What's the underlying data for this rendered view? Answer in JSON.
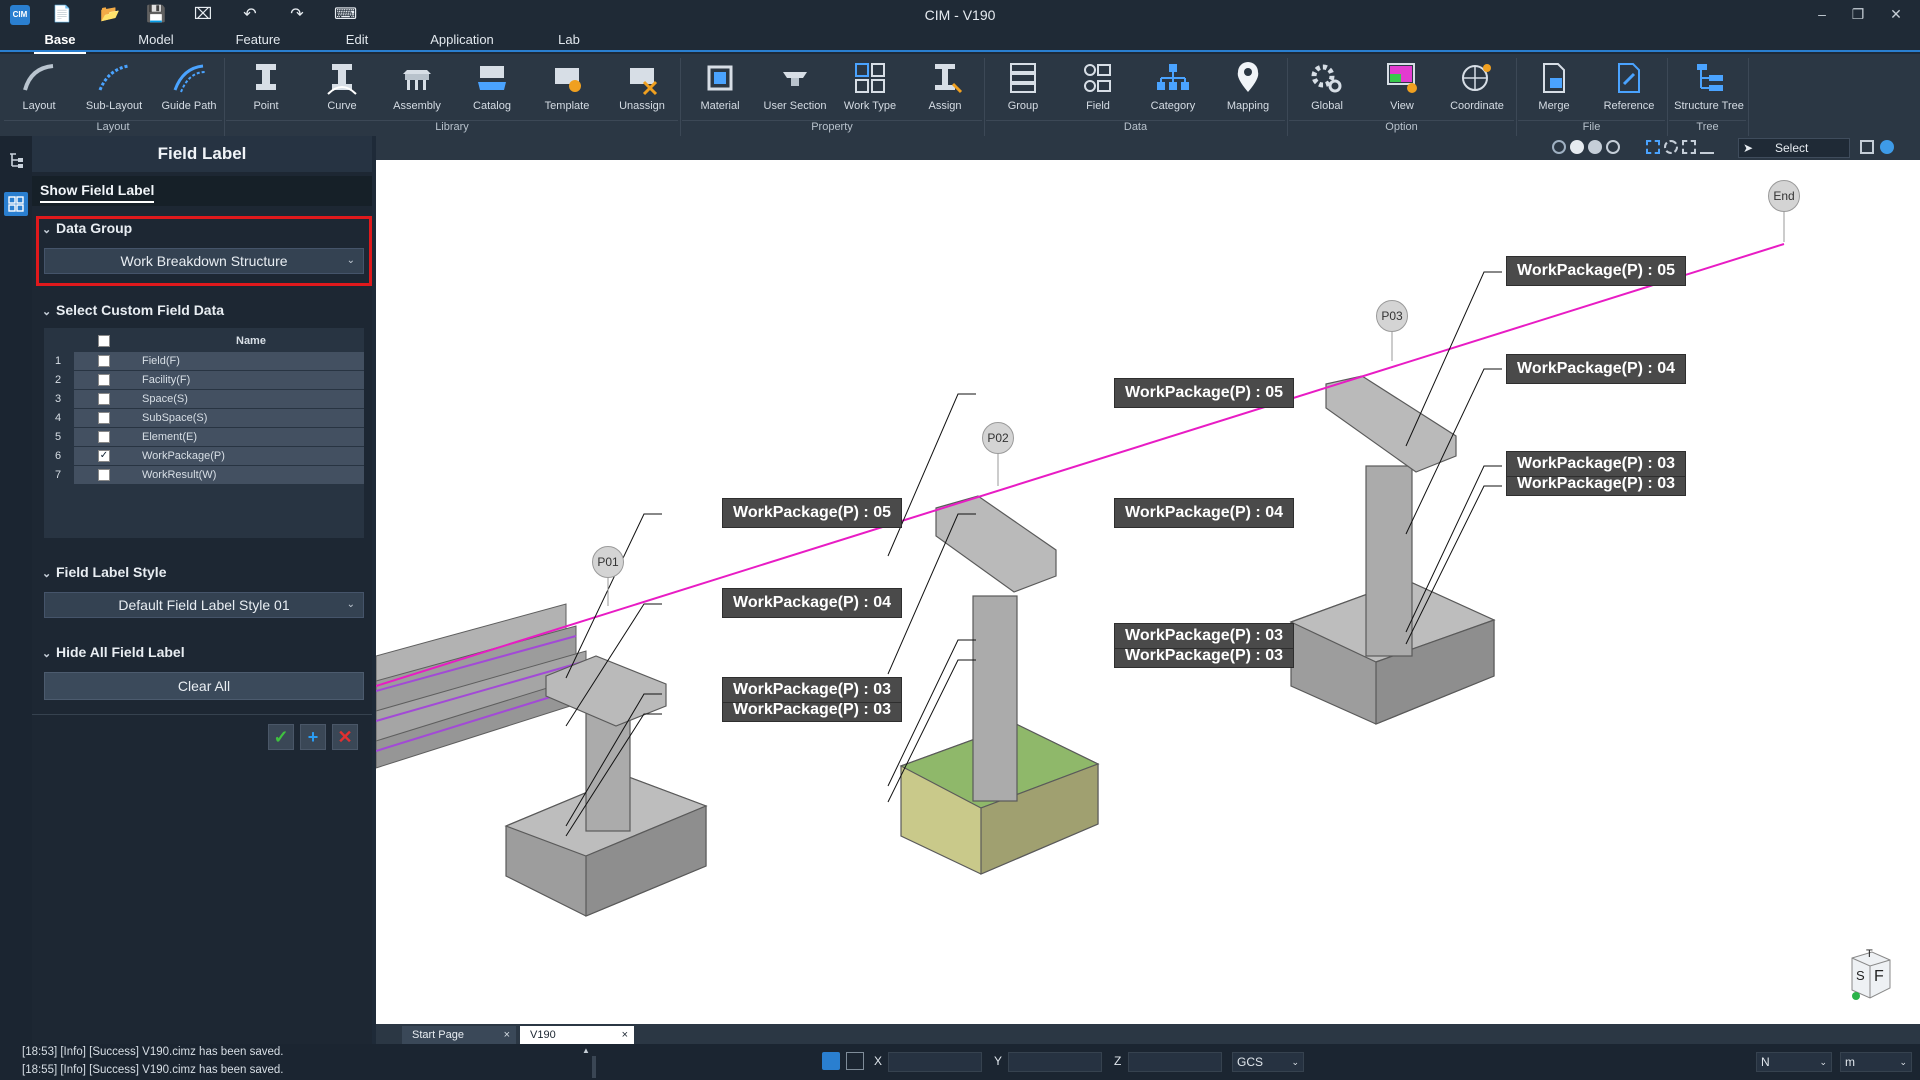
{
  "window": {
    "title": "CIM - V190"
  },
  "menu": {
    "tabs": [
      {
        "label": "Base"
      },
      {
        "label": "Model"
      },
      {
        "label": "Feature"
      },
      {
        "label": "Edit"
      },
      {
        "label": "Application"
      },
      {
        "label": "Lab"
      }
    ]
  },
  "ribbon": {
    "buttons": [
      {
        "label": "Layout",
        "icon": "layout-icon"
      },
      {
        "label": "Sub-Layout",
        "icon": "sub-layout-icon"
      },
      {
        "label": "Guide Path",
        "icon": "guide-path-icon"
      },
      {
        "label": "Point",
        "icon": "point-icon"
      },
      {
        "label": "Curve",
        "icon": "curve-icon"
      },
      {
        "label": "Assembly",
        "icon": "assembly-icon"
      },
      {
        "label": "Catalog",
        "icon": "catalog-icon"
      },
      {
        "label": "Template",
        "icon": "template-icon"
      },
      {
        "label": "Unassign",
        "icon": "unassign-icon"
      },
      {
        "label": "Material",
        "icon": "material-icon"
      },
      {
        "label": "User Section",
        "icon": "user-section-icon"
      },
      {
        "label": "Work Type",
        "icon": "work-type-icon"
      },
      {
        "label": "Assign",
        "icon": "assign-icon"
      },
      {
        "label": "Group",
        "icon": "group-icon"
      },
      {
        "label": "Field",
        "icon": "field-icon"
      },
      {
        "label": "Category",
        "icon": "category-icon"
      },
      {
        "label": "Mapping",
        "icon": "mapping-icon"
      },
      {
        "label": "Global",
        "icon": "global-icon"
      },
      {
        "label": "View",
        "icon": "view-icon"
      },
      {
        "label": "Coordinate",
        "icon": "coordinate-icon"
      },
      {
        "label": "Merge",
        "icon": "merge-icon"
      },
      {
        "label": "Reference",
        "icon": "reference-icon"
      },
      {
        "label": "Structure Tree",
        "icon": "structure-tree-icon"
      }
    ],
    "groups": [
      {
        "label": "Layout"
      },
      {
        "label": "Library"
      },
      {
        "label": "Property"
      },
      {
        "label": "Data"
      },
      {
        "label": "Option"
      },
      {
        "label": "File"
      },
      {
        "label": "Tree"
      }
    ]
  },
  "panel": {
    "title": "Field Label",
    "show_field_label": "Show Field Label",
    "data_group": {
      "heading": "Data Group",
      "value": "Work Breakdown Structure"
    },
    "custom_field": {
      "heading": "Select Custom Field Data",
      "column": "Name",
      "rows": [
        {
          "n": "1",
          "name": "Field(F)",
          "checked": false
        },
        {
          "n": "2",
          "name": "Facility(F)",
          "checked": false
        },
        {
          "n": "3",
          "name": "Space(S)",
          "checked": false
        },
        {
          "n": "4",
          "name": "SubSpace(S)",
          "checked": false
        },
        {
          "n": "5",
          "name": "Element(E)",
          "checked": false
        },
        {
          "n": "6",
          "name": "WorkPackage(P)",
          "checked": true
        },
        {
          "n": "7",
          "name": "WorkResult(W)",
          "checked": false
        }
      ]
    },
    "label_style": {
      "heading": "Field Label Style",
      "value": "Default Field Label Style 01"
    },
    "hide_all": {
      "heading": "Hide All Field Label",
      "button": "Clear All"
    }
  },
  "viewport": {
    "select_label": "Select",
    "markers": [
      "P01",
      "P02",
      "P03",
      "End"
    ],
    "labels": [
      "WorkPackage(P) : 05",
      "WorkPackage(P) : 04",
      "WorkPackage(P) : 03",
      "WorkPackage(P) : 03"
    ],
    "cube": {
      "top": "T",
      "front": "F",
      "side": "S"
    }
  },
  "doc_tabs": [
    {
      "label": "Start Page"
    },
    {
      "label": "V190"
    }
  ],
  "log": [
    "[18:53] [Info] [Success] V190.cimz has been saved.",
    "[18:55] [Info] [Success] V190.cimz has been saved."
  ],
  "status": {
    "x": "X",
    "y": "Y",
    "z": "Z",
    "cs": "GCS",
    "dir": "N",
    "unit": "m"
  },
  "colors": {
    "accent": "#2a7fd0",
    "alignment": "#e81cc4",
    "highlight": "#e0191c"
  }
}
